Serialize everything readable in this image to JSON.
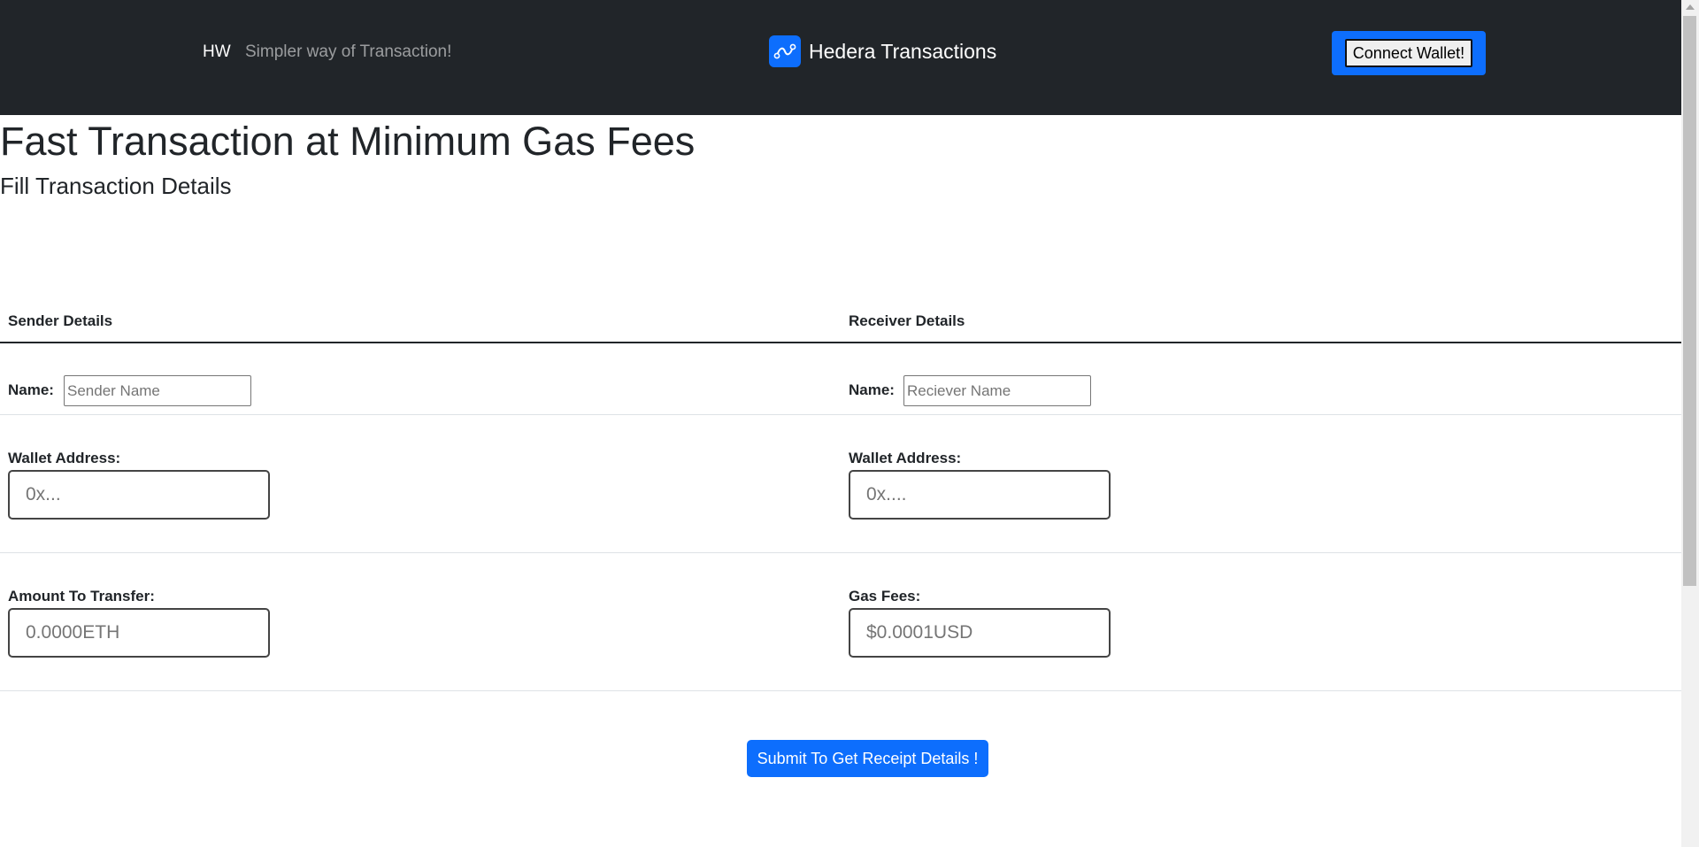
{
  "navbar": {
    "brand_short": "HW",
    "tagline": "Simpler way of Transaction!",
    "logo_icon": "route-icon",
    "center_title": "Hedera Transactions",
    "connect_label": "Connect Wallet!",
    "accent_color": "#0d6efd",
    "background_color": "#212529"
  },
  "hero": {
    "title": "Fast Transaction at Minimum Gas Fees",
    "subtitle": "Fill Transaction Details"
  },
  "form": {
    "sender_heading": "Sender Details",
    "receiver_heading": "Receiver Details",
    "sender_name_label": "Name:",
    "sender_name_placeholder": "Sender Name",
    "receiver_name_label": "Name:",
    "receiver_name_placeholder": "Reciever Name",
    "sender_wallet_label": "Wallet Address:",
    "sender_wallet_placeholder": "0x...",
    "receiver_wallet_label": "Wallet Address:",
    "receiver_wallet_placeholder": "0x....",
    "amount_label": "Amount To Transfer:",
    "amount_placeholder": "0.0000ETH",
    "gas_label": "Gas Fees:",
    "gas_placeholder": "$0.0001USD",
    "submit_label": "Submit To Get Receipt Details !"
  }
}
